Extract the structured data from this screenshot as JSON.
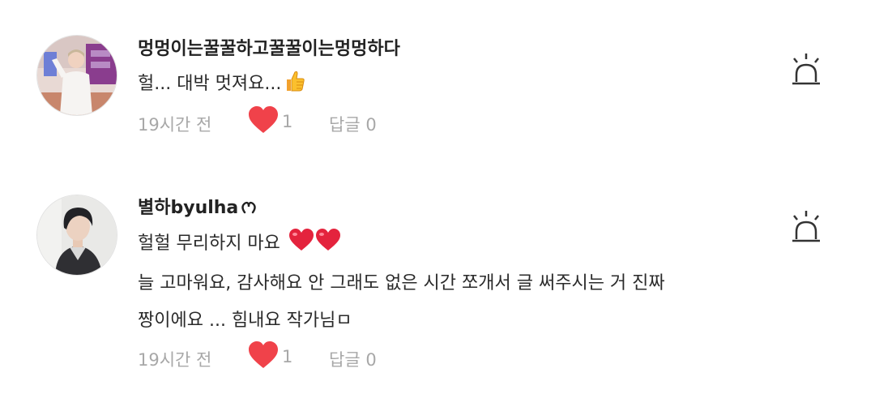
{
  "comments": [
    {
      "author": "멍멍이는꿀꿀하고꿀꿀이는멍멍하다",
      "lines": [
        "헐... 대박 멋져요..."
      ],
      "emoji": "thumbs-up-icon",
      "time": "19시간 전",
      "likes": "1",
      "reply_label": "답글 0"
    },
    {
      "author": "별하byulha",
      "author_suffix_icon": "ribbon-icon",
      "lines": [
        "헐헐 무리하지 마요",
        "늘 고마워요, 감사해요 안 그래도 없은 시간 쪼개서 글 써주시는 거 진짜",
        "짱이에요 ... 힘내요 작가님ㅁ"
      ],
      "emoji": "two-hearts-icon",
      "time": "19시간 전",
      "likes": "1",
      "reply_label": "답글 0"
    }
  ],
  "colors": {
    "heart": "#f0424a",
    "meta_text": "#a8a8a8",
    "author_text": "#222222"
  },
  "icons": {
    "like": "heart-icon",
    "report": "siren-icon"
  }
}
